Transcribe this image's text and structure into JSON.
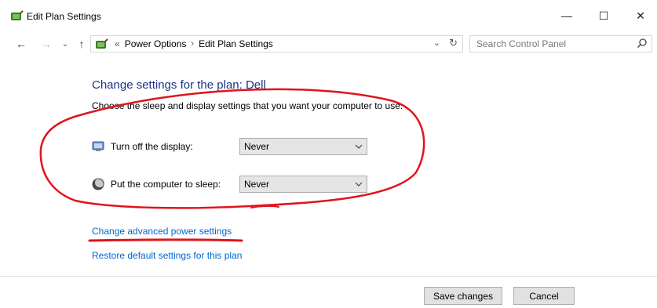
{
  "window": {
    "title": "Edit Plan Settings",
    "minimize_glyph": "—",
    "maximize_glyph": "☐",
    "close_glyph": "✕"
  },
  "navigation": {
    "back_glyph": "←",
    "forward_glyph": "→",
    "recent_glyph": "⌄",
    "up_glyph": "↑",
    "breadcrumb_separator": "«",
    "breadcrumbs": [
      "Power Options",
      "Edit Plan Settings"
    ],
    "breadcrumb_arrow": "›",
    "dropdown_glyph": "⌄",
    "refresh_glyph": "↻",
    "search_placeholder": "Search Control Panel"
  },
  "content": {
    "title": "Change settings for the plan: Dell",
    "description": "Choose the sleep and display settings that you want your computer to use.",
    "settings": [
      {
        "label": "Turn off the display:",
        "value": "Never",
        "icon": "display-icon"
      },
      {
        "label": "Put the computer to sleep:",
        "value": "Never",
        "icon": "moon-icon"
      }
    ],
    "links": {
      "advanced": "Change advanced power settings",
      "restore": "Restore default settings for this plan"
    }
  },
  "buttons": {
    "save": "Save changes",
    "cancel": "Cancel"
  },
  "colors": {
    "title_blue": "#1e3287",
    "link_blue": "#0066cc",
    "annotation_red": "#e0141b"
  }
}
